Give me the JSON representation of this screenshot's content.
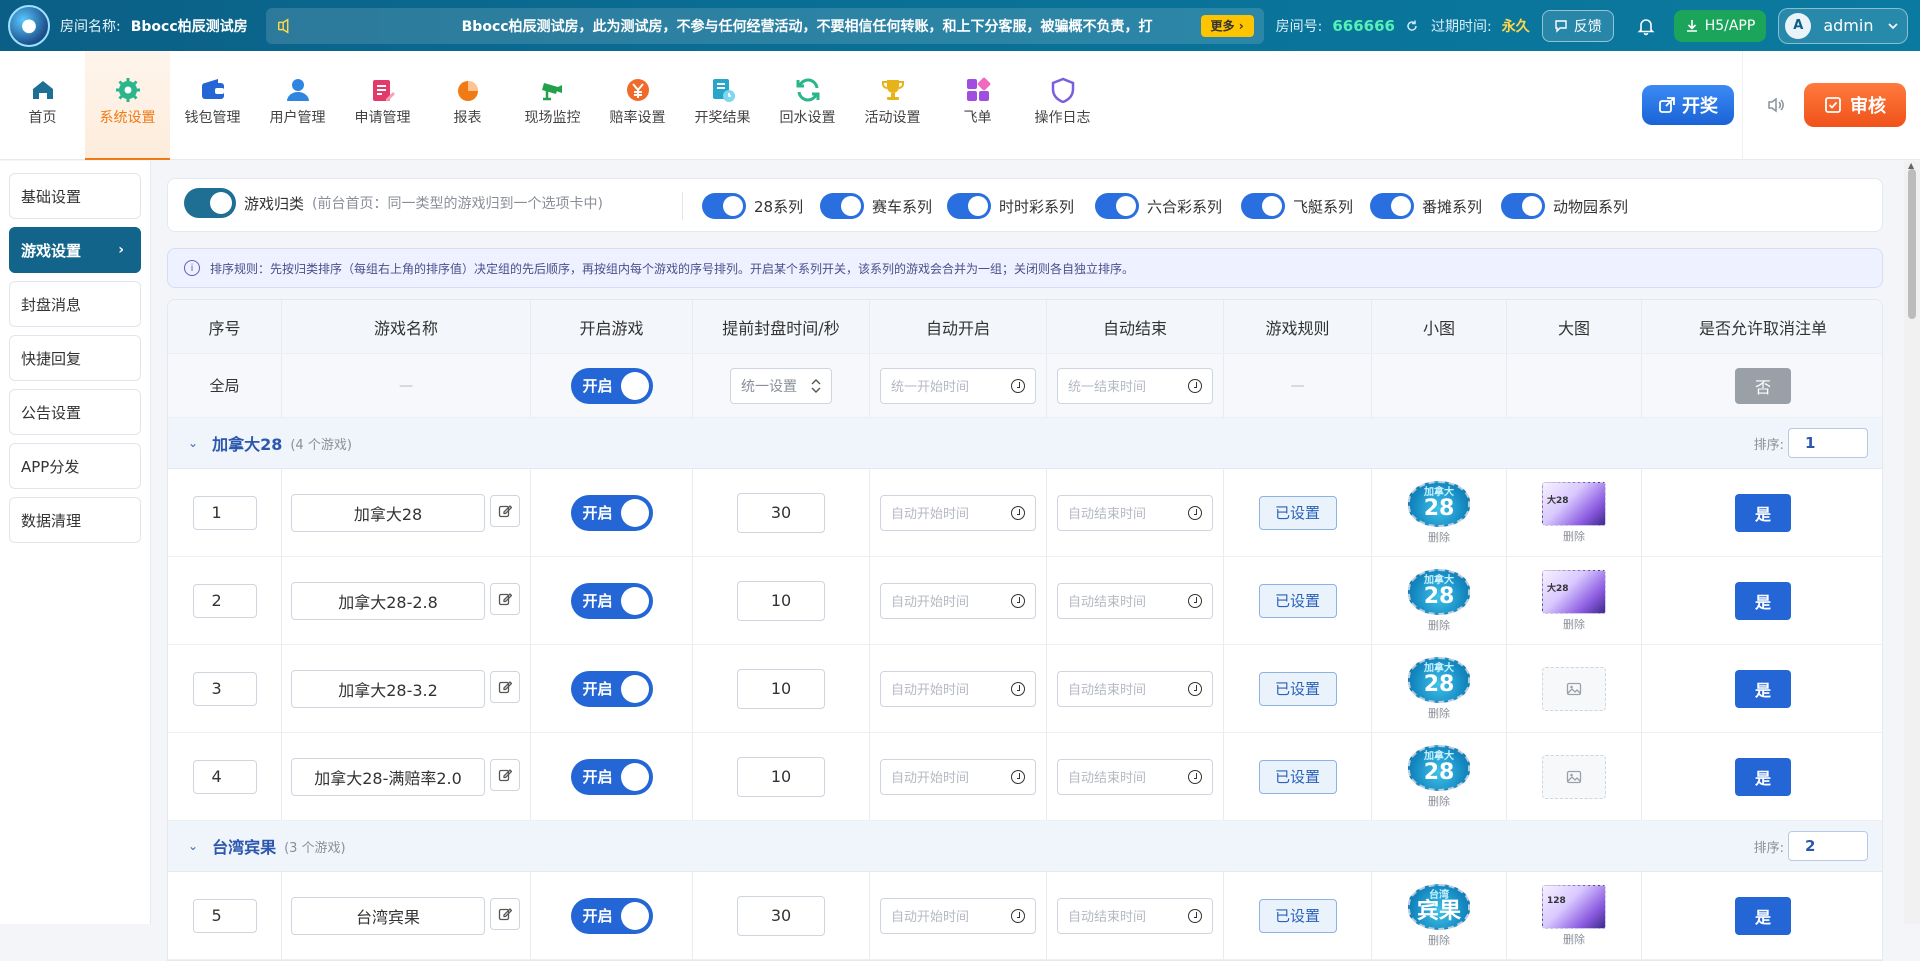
{
  "topbar": {
    "room_label": "房间名称:",
    "room_name": "Bbocc柏辰测试房",
    "notice": "Bbocc柏辰测试房，此为测试房，不参与任何经营活动，不要相信任何转账，和上下分客服，被骗概不负责，打",
    "more_label": "更多 ›",
    "room_no_label": "房间号:",
    "room_no": "666666",
    "expire_label": "过期时间:",
    "expire_value": "永久",
    "feedback_label": "反馈",
    "h5_label": "H5/APP",
    "avatar_letter": "A",
    "user_name": "admin"
  },
  "nav": {
    "items": [
      {
        "label": "首页",
        "icon": "home-icon",
        "color": "#1d6f95"
      },
      {
        "label": "系统设置",
        "icon": "gear-icon",
        "color": "#2bb58a"
      },
      {
        "label": "钱包管理",
        "icon": "wallet-icon",
        "color": "#2566d6"
      },
      {
        "label": "用户管理",
        "icon": "user-icon",
        "color": "#2f86e0"
      },
      {
        "label": "申请管理",
        "icon": "form-edit-icon",
        "color": "#e23b6a"
      },
      {
        "label": "报表",
        "icon": "pie-chart-icon",
        "color": "#f07a16"
      },
      {
        "label": "现场监控",
        "icon": "camera-icon",
        "color": "#22a04a"
      },
      {
        "label": "赔率设置",
        "icon": "odds-icon",
        "color": "#f06a2a"
      },
      {
        "label": "开奖结果",
        "icon": "result-icon",
        "color": "#27a6c9"
      },
      {
        "label": "回水设置",
        "icon": "refresh-icon",
        "color": "#2bb58a"
      },
      {
        "label": "活动设置",
        "icon": "trophy-icon",
        "color": "#e8b21a"
      },
      {
        "label": "飞单",
        "icon": "grid-icon",
        "color": "#a04ee0"
      },
      {
        "label": "操作日志",
        "icon": "shield-icon",
        "color": "#7a5ee0"
      }
    ],
    "draw_label": "开奖",
    "review_label": "审核"
  },
  "sidebar": {
    "items": [
      "基础设置",
      "游戏设置",
      "封盘消息",
      "快捷回复",
      "公告设置",
      "APP分发",
      "数据清理"
    ]
  },
  "series": {
    "main_label": "游戏归类",
    "main_hint": "(前台首页：同一类型的游戏归到一个选项卡中)",
    "toggles": [
      "28系列",
      "赛车系列",
      "时时彩系列",
      "六合彩系列",
      "飞艇系列",
      "番摊系列",
      "动物园系列"
    ]
  },
  "rule_text": "排序规则：先按归类排序（每组右上角的排序值）决定组的先后顺序，再按组内每个游戏的序号排列。开启某个系列开关，该系列的游戏会合并为一组；关闭则各自独立排序。",
  "table": {
    "headers": [
      "序号",
      "游戏名称",
      "开启游戏",
      "提前封盘时间/秒",
      "自动开启",
      "自动结束",
      "游戏规则",
      "小图",
      "大图",
      "是否允许取消注单"
    ],
    "global": {
      "seq": "全局",
      "name": "—",
      "on_label": "开启",
      "uniform_set": "统一设置",
      "start_placeholder": "统一开始时间",
      "end_placeholder": "统一结束时间",
      "rule": "—",
      "cancel": "否"
    },
    "start_placeholder": "自动开始时间",
    "end_placeholder": "自动结束时间",
    "on_label": "开启",
    "set_label": "已设置",
    "delete_label": "删除",
    "yes_label": "是",
    "sort_label": "排序:",
    "groups": [
      {
        "name": "加拿大28",
        "count": "(4 个游戏)",
        "sort": "1",
        "rows": [
          {
            "seq": "1",
            "name": "加拿大28",
            "seconds": "30",
            "small_top": "加拿大",
            "small_num": "28",
            "large": true,
            "large_text": "大28"
          },
          {
            "seq": "2",
            "name": "加拿大28-2.8",
            "seconds": "10",
            "small_top": "加拿大",
            "small_num": "28",
            "large": true,
            "large_text": "大28"
          },
          {
            "seq": "3",
            "name": "加拿大28-3.2",
            "seconds": "10",
            "small_top": "加拿大",
            "small_num": "28",
            "large": false,
            "large_text": ""
          },
          {
            "seq": "4",
            "name": "加拿大28-满赔率2.0",
            "seconds": "10",
            "small_top": "加拿大",
            "small_num": "28",
            "large": false,
            "large_text": ""
          }
        ]
      },
      {
        "name": "台湾宾果",
        "count": "(3 个游戏)",
        "sort": "2",
        "rows": [
          {
            "seq": "5",
            "name": "台湾宾果",
            "seconds": "30",
            "small_top": "台湾",
            "small_num": "宾果",
            "large": true,
            "large_text": "128"
          }
        ]
      }
    ]
  }
}
